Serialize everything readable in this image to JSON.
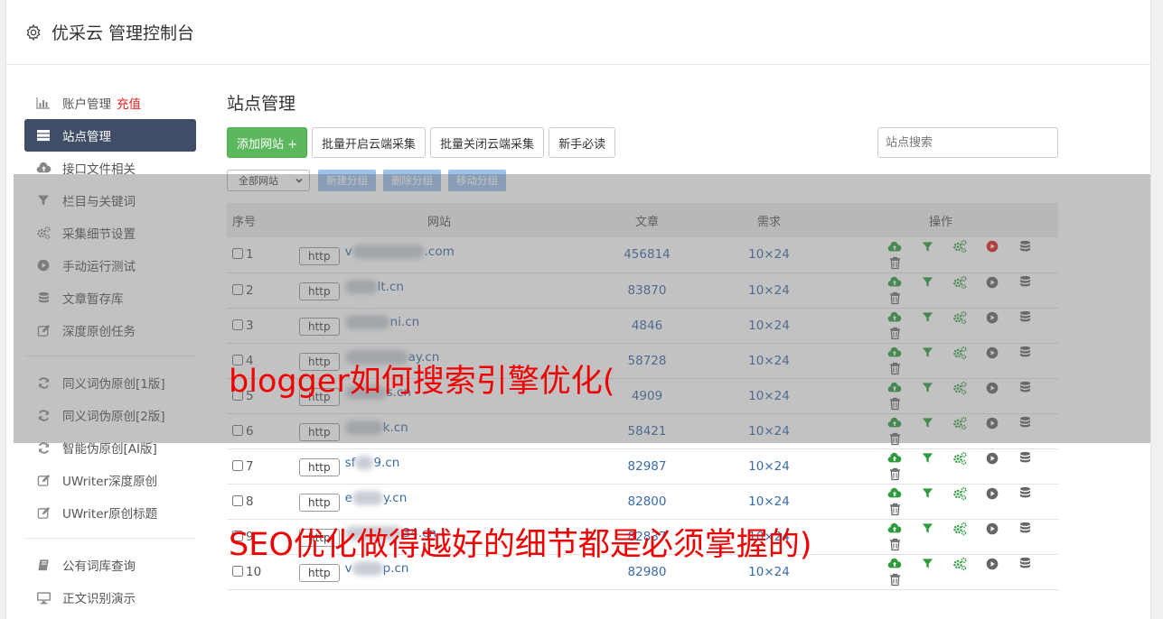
{
  "header": {
    "title": "优采云 管理控制台",
    "icon": "gear-icon"
  },
  "sidebar": {
    "group1": [
      {
        "icon": "bar-chart-icon",
        "label": "账户管理",
        "extra": "充值",
        "active": false
      },
      {
        "icon": "server-list-icon",
        "label": "站点管理",
        "active": true
      },
      {
        "icon": "cloud-upload-icon",
        "label": "接口文件相关",
        "active": false
      },
      {
        "icon": "filter-icon",
        "label": "栏目与关键词",
        "active": false
      },
      {
        "icon": "cogs-icon",
        "label": "采集细节设置",
        "active": false
      },
      {
        "icon": "play-circle-icon",
        "label": "手动运行测试",
        "active": false
      },
      {
        "icon": "database-icon",
        "label": "文章暂存库",
        "active": false
      },
      {
        "icon": "edit-icon",
        "label": "深度原创任务",
        "active": false
      }
    ],
    "group2": [
      {
        "icon": "refresh-icon",
        "label": "同义词伪原创[1版]"
      },
      {
        "icon": "refresh-icon",
        "label": "同义词伪原创[2版]"
      },
      {
        "icon": "refresh-icon",
        "label": "智能伪原创[AI版]"
      },
      {
        "icon": "edit-icon",
        "label": "UWriter深度原创"
      },
      {
        "icon": "edit-icon",
        "label": "UWriter原创标题"
      }
    ],
    "group3": [
      {
        "icon": "book-icon",
        "label": "公有词库查询"
      },
      {
        "icon": "monitor-icon",
        "label": "正文识别演示"
      }
    ]
  },
  "main": {
    "title": "站点管理",
    "add_button": "添加网站 +",
    "batch_open": "批量开启云端采集",
    "batch_close": "批量关闭云端采集",
    "guide": "新手必读",
    "search_placeholder": "站点搜索",
    "group_select": "全部网站",
    "new_group": "新建分组",
    "delete_group": "删除分组",
    "move_group": "移动分组"
  },
  "table": {
    "headers": {
      "no": "序号",
      "site": "网站",
      "articles": "文章",
      "demand": "需求",
      "ops": "操作"
    },
    "rows": [
      {
        "no": "1",
        "protocol": "http",
        "pre": "v",
        "suffix": ".com",
        "articles": "456814",
        "demand": "10×24",
        "running": true
      },
      {
        "no": "2",
        "protocol": "http",
        "pre": "",
        "suffix": "lt.cn",
        "articles": "83870",
        "demand": "10×24",
        "running": false
      },
      {
        "no": "3",
        "protocol": "http",
        "pre": "",
        "suffix": "ni.cn",
        "articles": "4846",
        "demand": "10×24",
        "running": false
      },
      {
        "no": "4",
        "protocol": "http",
        "pre": "",
        "suffix": "ay.cn",
        "articles": "58728",
        "demand": "10×24",
        "running": false
      },
      {
        "no": "5",
        "protocol": "http",
        "pre": "",
        "suffix": "s.cn",
        "articles": "4909",
        "demand": "10×24",
        "running": false
      },
      {
        "no": "6",
        "protocol": "http",
        "pre": "",
        "suffix": "k.cn",
        "articles": "58421",
        "demand": "10×24",
        "running": false
      },
      {
        "no": "7",
        "protocol": "http",
        "pre": "sf",
        "suffix": "9.cn",
        "articles": "82987",
        "demand": "10×24",
        "running": false
      },
      {
        "no": "8",
        "protocol": "http",
        "pre": "e",
        "suffix": "y.cn",
        "articles": "82800",
        "demand": "10×24",
        "running": false
      },
      {
        "no": "9",
        "protocol": "http",
        "pre": "",
        "suffix": "34.cn",
        "articles": "82837",
        "demand": "10×24",
        "running": false
      },
      {
        "no": "10",
        "protocol": "http",
        "pre": "v",
        "suffix": "p.cn",
        "articles": "82980",
        "demand": "10×24",
        "running": false
      }
    ]
  },
  "captions": {
    "line1": "blogger如何搜索引擎优化(",
    "line2": "SEO优化做得越好的细节都是必须掌握的)"
  },
  "colors": {
    "green": "#5cb85c",
    "active_nav": "#3f4e66",
    "link": "#3a6aa8",
    "caption": "#f00000",
    "run_red": "#e02020"
  }
}
